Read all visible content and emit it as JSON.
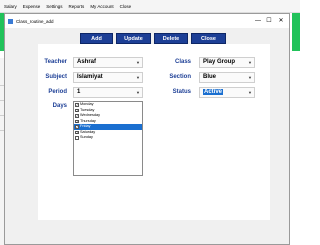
{
  "menubar": {
    "items": [
      "Salary",
      "Expense",
      "Settings",
      "Reports",
      "My Account",
      "Close"
    ]
  },
  "dialog": {
    "title": "Class_routine_add",
    "min": "—",
    "max": "☐",
    "close": "✕"
  },
  "toolbar": {
    "add": "Add",
    "update": "Update",
    "delete": "Delete",
    "close": "Close"
  },
  "form": {
    "teacher_label": "Teacher",
    "teacher": "Ashraf",
    "subject_label": "Subject",
    "subject": "Islamiyat",
    "period_label": "Period",
    "period": "1",
    "days_label": "Days",
    "class_label": "Class",
    "class": "Play Group",
    "section_label": "Section",
    "section": "Blue",
    "status_label": "Status",
    "status": "Active",
    "days": [
      {
        "name": "Monday",
        "checked": true,
        "selected": false
      },
      {
        "name": "Tuesday",
        "checked": true,
        "selected": false
      },
      {
        "name": "Wednesday",
        "checked": true,
        "selected": false
      },
      {
        "name": "Thursday",
        "checked": true,
        "selected": false
      },
      {
        "name": "Friday",
        "checked": true,
        "selected": true
      },
      {
        "name": "Saturday",
        "checked": true,
        "selected": false
      },
      {
        "name": "Sunday",
        "checked": false,
        "selected": false
      }
    ],
    "check_glyph": "✓"
  },
  "colors": {
    "accent": "#1d3f96",
    "selection": "#1a6fd0",
    "app_green": "#21c25a"
  }
}
